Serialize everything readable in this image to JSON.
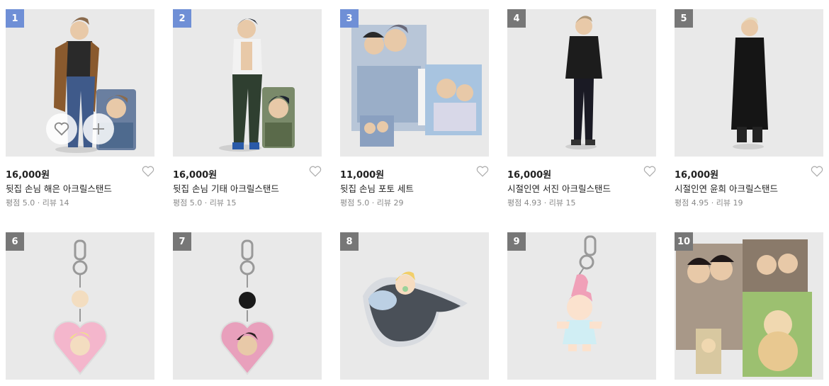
{
  "products": [
    {
      "rank": "1",
      "price": "16,000원",
      "name": "뒷집 손님 해은 아크릴스탠드",
      "rating": "평점 5.0",
      "reviews": "리뷰 14",
      "rank_color": "blue",
      "art": "standee-brown"
    },
    {
      "rank": "2",
      "price": "16,000원",
      "name": "뒷집 손님 기태 아크릴스탠드",
      "rating": "평점 5.0",
      "reviews": "리뷰 15",
      "rank_color": "blue",
      "art": "standee-white"
    },
    {
      "rank": "3",
      "price": "11,000원",
      "name": "뒷집 손님 포토 세트",
      "rating": "평점 5.0",
      "reviews": "리뷰 29",
      "rank_color": "blue",
      "art": "photos"
    },
    {
      "rank": "4",
      "price": "16,000원",
      "name": "시절인연 서진 아크릴스탠드",
      "rating": "평점 4.93",
      "reviews": "리뷰 15",
      "rank_color": "gray",
      "art": "standee-black"
    },
    {
      "rank": "5",
      "price": "16,000원",
      "name": "시절인연 윤희 아크릴스탠드",
      "rating": "평점 4.95",
      "reviews": "리뷰 19",
      "rank_color": "gray",
      "art": "standee-coat"
    },
    {
      "rank": "6",
      "rank_color": "gray",
      "art": "keyring-heart-pink"
    },
    {
      "rank": "7",
      "rank_color": "gray",
      "art": "keyring-heart-dark"
    },
    {
      "rank": "8",
      "rank_color": "gray",
      "art": "seal"
    },
    {
      "rank": "9",
      "rank_color": "gray",
      "art": "keyring-baby"
    },
    {
      "rank": "10",
      "rank_color": "gray",
      "art": "photos-2"
    }
  ],
  "colors": {
    "rank_blue": "#6f8fd6",
    "rank_gray": "#777777",
    "thumb_bg": "#e9e9e9"
  },
  "icons": {
    "wish": "heart-icon",
    "overlay_wish": "heart-outline-icon",
    "overlay_add": "plus-icon"
  }
}
